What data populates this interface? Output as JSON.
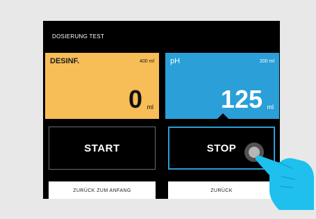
{
  "screen": {
    "title": "DOSIERUNG TEST"
  },
  "desinf": {
    "label": "DESINF.",
    "max": "400 ml",
    "value": "0",
    "unit": "ml",
    "color": "#f7bd56"
  },
  "ph": {
    "label": "pH",
    "max": "200 ml",
    "value": "125",
    "unit": "ml",
    "color": "#2a9fd8"
  },
  "buttons": {
    "start_label": "START",
    "stop_label": "STOP",
    "back_to_start_label": "ZURÜCK ZUM ANFANG",
    "back_label": "ZURÜCK"
  },
  "icons": {
    "touch": "touch-indicator-icon",
    "hand": "pointing-hand-icon"
  }
}
